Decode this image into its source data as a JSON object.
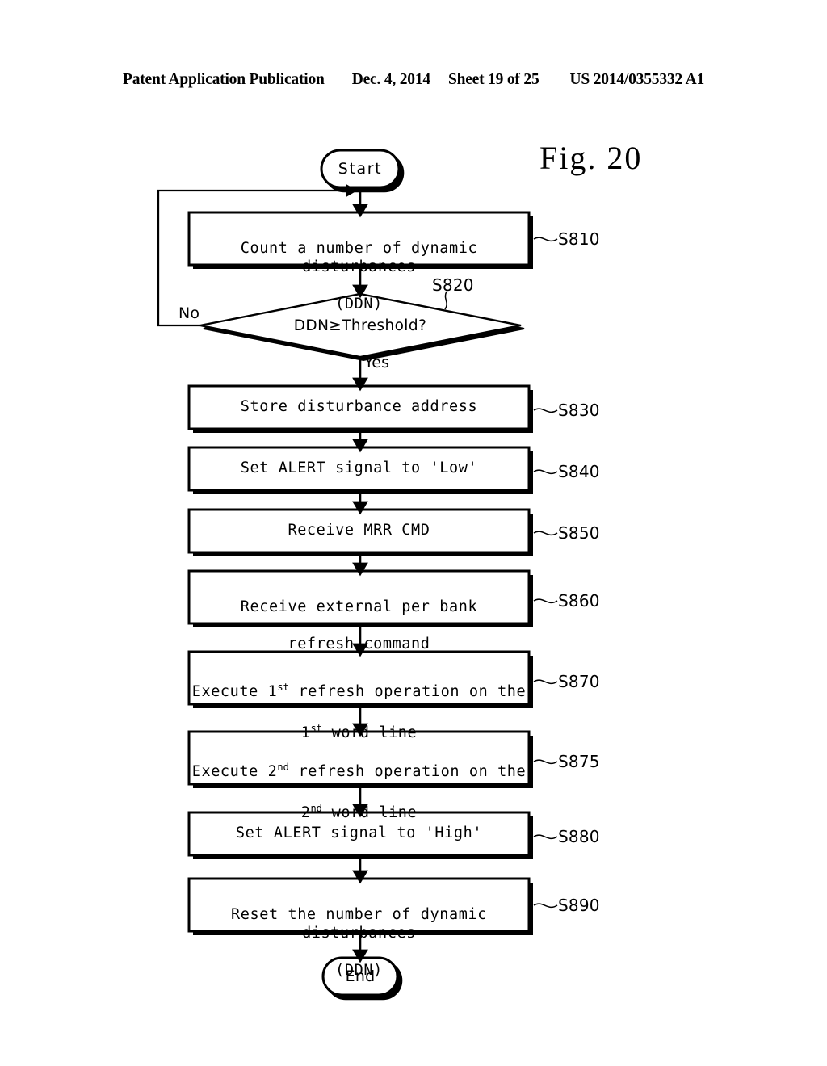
{
  "header": {
    "publication": "Patent Application Publication",
    "date": "Dec. 4, 2014",
    "sheet": "Sheet 19 of 25",
    "number": "US 2014/0355332 A1"
  },
  "figure": {
    "title": "Fig. 20",
    "type": "flowchart"
  },
  "flowchart": {
    "start_label": "Start",
    "end_label": "End",
    "branch_no": "No",
    "branch_yes": "Yes",
    "decision": {
      "text": "DDN≥Threshold?",
      "step": "S820"
    },
    "steps": [
      {
        "id": "s810",
        "line1": "Count a number of dynamic disturbances",
        "line2": "(DDN)",
        "step": "S810"
      },
      {
        "id": "s830",
        "line1": "Store disturbance address",
        "line2": "",
        "step": "S830"
      },
      {
        "id": "s840",
        "line1": "Set ALERT signal to 'Low'",
        "line2": "",
        "step": "S840"
      },
      {
        "id": "s850",
        "line1": "Receive MRR CMD",
        "line2": "",
        "step": "S850"
      },
      {
        "id": "s860",
        "line1": "Receive external per bank",
        "line2": "refresh command",
        "step": "S860"
      },
      {
        "id": "s870",
        "line1": "Execute 1st refresh operation on the",
        "line2": "1st word line",
        "step": "S870"
      },
      {
        "id": "s875",
        "line1": "Execute 2nd refresh operation on the",
        "line2": "2nd word line",
        "step": "S875"
      },
      {
        "id": "s880",
        "line1": "Set ALERT signal to 'High'",
        "line2": "",
        "step": "S880"
      },
      {
        "id": "s890",
        "line1": "Reset the number of dynamic disturbances",
        "line2": "(DDN)",
        "step": "S890"
      }
    ]
  },
  "colors": {
    "ink": "#000000",
    "paper": "#ffffff"
  }
}
